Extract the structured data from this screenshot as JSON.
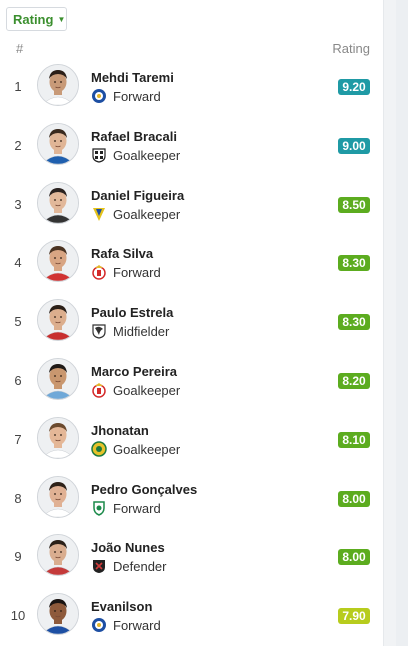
{
  "sort_dropdown": {
    "label": "Rating"
  },
  "headers": {
    "rank": "#",
    "rating": "Rating"
  },
  "players": [
    {
      "rank": "1",
      "name": "Mehdi Taremi",
      "position": "Forward",
      "rating": "9.20",
      "rating_color": "#1f9aa5",
      "club_icon": "fc-porto-crest-icon",
      "club_color": "#1d4fa3",
      "skin": "#c89a78",
      "hair": "#2b1f18",
      "shirt": "#ffffff"
    },
    {
      "rank": "2",
      "name": "Rafael Bracali",
      "position": "Goalkeeper",
      "rating": "9.00",
      "rating_color": "#1f9aa5",
      "club_icon": "boavista-crest-icon",
      "club_color": "#222222",
      "skin": "#e0b596",
      "hair": "#3a2a1e",
      "shirt": "#1f5fae"
    },
    {
      "rank": "3",
      "name": "Daniel Figueira",
      "position": "Goalkeeper",
      "rating": "8.50",
      "rating_color": "#5cac1f",
      "club_icon": "estoril-crest-icon",
      "club_color": "#e4c21b",
      "skin": "#e2b89a",
      "hair": "#2a2220",
      "shirt": "#333333"
    },
    {
      "rank": "4",
      "name": "Rafa Silva",
      "position": "Forward",
      "rating": "8.30",
      "rating_color": "#5cac1f",
      "club_icon": "benfica-crest-icon",
      "club_color": "#d42a2a",
      "skin": "#d8a583",
      "hair": "#4a3322",
      "shirt": "#d13232"
    },
    {
      "rank": "5",
      "name": "Paulo Estrela",
      "position": "Midfielder",
      "rating": "8.30",
      "rating_color": "#5cac1f",
      "club_icon": "vitoria-crest-icon",
      "club_color": "#333333",
      "skin": "#dcae8d",
      "hair": "#2b2019",
      "shirt": "#c82f2f"
    },
    {
      "rank": "6",
      "name": "Marco Pereira",
      "position": "Goalkeeper",
      "rating": "8.20",
      "rating_color": "#5cac1f",
      "club_icon": "benfica-crest-icon",
      "club_color": "#d42a2a",
      "skin": "#c9976f",
      "hair": "#1f1a17",
      "shirt": "#6fa8d8"
    },
    {
      "rank": "7",
      "name": "Jhonatan",
      "position": "Goalkeeper",
      "rating": "8.10",
      "rating_color": "#5cac1f",
      "club_icon": "rio-ave-crest-icon",
      "club_color": "#1c7a3d",
      "skin": "#e4b797",
      "hair": "#6b4a2e",
      "shirt": "#ffffff"
    },
    {
      "rank": "8",
      "name": "Pedro Gonçalves",
      "position": "Forward",
      "rating": "8.00",
      "rating_color": "#5cac1f",
      "club_icon": "sporting-crest-icon",
      "club_color": "#1b8a4a",
      "skin": "#e0b194",
      "hair": "#2e2219",
      "shirt": "#ffffff"
    },
    {
      "rank": "9",
      "name": "João Nunes",
      "position": "Defender",
      "rating": "8.00",
      "rating_color": "#5cac1f",
      "club_icon": "gil-vicente-crest-icon",
      "club_color": "#222222",
      "skin": "#d9ad8f",
      "hair": "#2a2018",
      "shirt": "#c43a3a"
    },
    {
      "rank": "10",
      "name": "Evanilson",
      "position": "Forward",
      "rating": "7.90",
      "rating_color": "#b7cc1d",
      "club_icon": "fc-porto-crest-icon",
      "club_color": "#1d4fa3",
      "skin": "#8e5a3b",
      "hair": "#1a1412",
      "shirt": "#1d4fa3"
    }
  ]
}
